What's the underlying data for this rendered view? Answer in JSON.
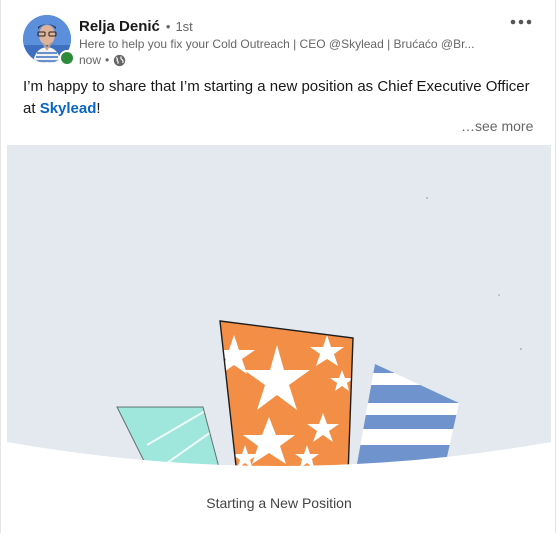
{
  "post": {
    "author": {
      "name": "Relja Denić",
      "separator": "•",
      "degree": "1st",
      "headline": "Here to help you fix your Cold Outreach | CEO @Skylead | Brućaćo @Br...",
      "time": "now",
      "time_separator": "•",
      "visibility_icon": "globe-icon",
      "presence_color": "#2e8b3a"
    },
    "more_icon": "more-horizontal-icon",
    "text": {
      "before": "I’m happy to share that I’m starting a new position as Chief Executive Officer at ",
      "company": "Skylead",
      "after": "!"
    },
    "see_more": "…see more",
    "media": {
      "title": "Starting a New Position",
      "background_color": "#e4e9ef",
      "colors": {
        "orange": "#f28e45",
        "teal": "#9fe6dd",
        "blue": "#6e93cd"
      }
    },
    "accent_color": "#0a66c2"
  }
}
